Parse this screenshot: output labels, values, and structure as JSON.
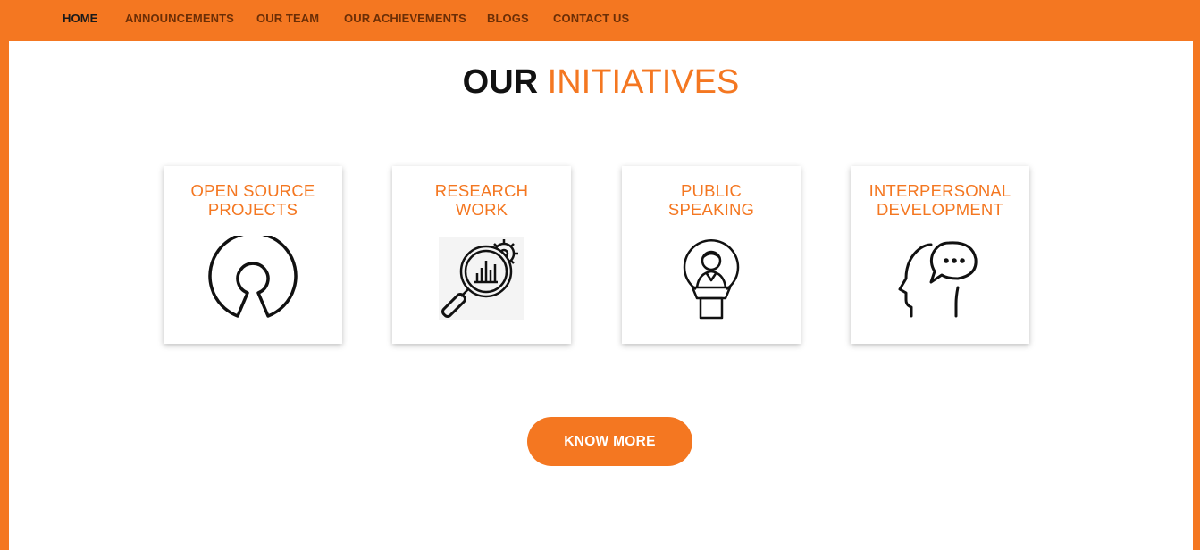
{
  "nav": {
    "items": [
      {
        "label": "HOME"
      },
      {
        "label": "ANNOUNCEMENTS"
      },
      {
        "label": "OUR TEAM"
      },
      {
        "label": "OUR ACHIEVEMENTS"
      },
      {
        "label": "BLOGS"
      },
      {
        "label": "CONTACT US"
      }
    ]
  },
  "section": {
    "title_dark": "OUR",
    "title_accent": "INITIATIVES"
  },
  "cards": [
    {
      "line1": "OPEN SOURCE",
      "line2": "PROJECTS",
      "icon": "open-source-icon"
    },
    {
      "line1": "RESEARCH",
      "line2": "WORK",
      "icon": "research-magnifier-icon"
    },
    {
      "line1": "PUBLIC",
      "line2": "SPEAKING",
      "icon": "podium-speaker-icon"
    },
    {
      "line1": "INTERPERSONAL",
      "line2": "DEVELOPMENT",
      "icon": "head-speech-bubble-icon"
    }
  ],
  "cta": {
    "label": "KNOW MORE"
  },
  "colors": {
    "accent": "#f47721",
    "nav_text": "#6b2e06",
    "nav_active": "#1a1a1a"
  }
}
